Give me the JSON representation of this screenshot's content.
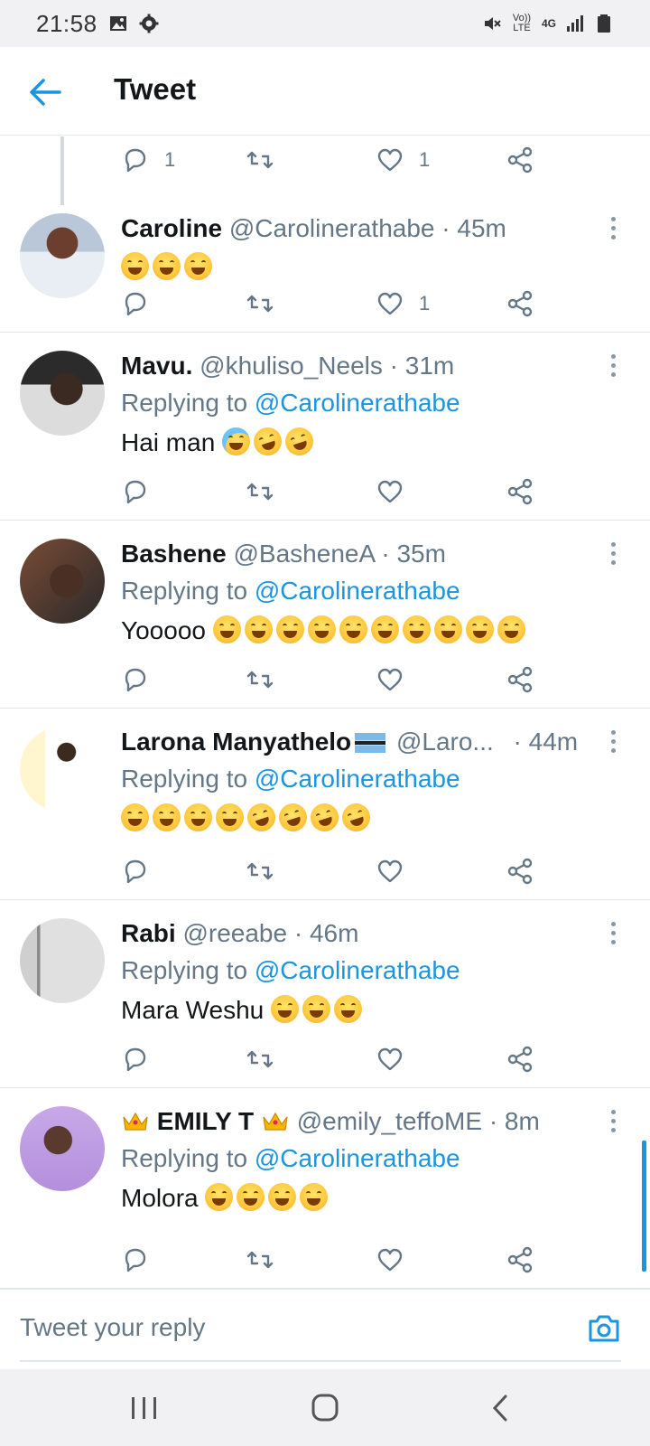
{
  "status_bar": {
    "time": "21:58",
    "left_icons": [
      "image-icon",
      "gear-icon"
    ],
    "right_icons": [
      "mute-icon",
      "volte-icon",
      "4g-icon",
      "signal-icon",
      "battery-icon"
    ],
    "volte_label": "Vo)) LTE",
    "network_label": "4G"
  },
  "header": {
    "title": "Tweet",
    "back_icon": "back-arrow-icon"
  },
  "colors": {
    "accent": "#1b95e0",
    "muted": "#657786",
    "text": "#14171a",
    "divider": "#e1e8ed"
  },
  "top_actions": {
    "reply_count": "1",
    "retweet_count": "",
    "like_count": "1"
  },
  "tweets": [
    {
      "name": "Caroline",
      "handle": "@Carolinerathabe",
      "time": "· 45m",
      "replying_prefix": "",
      "replying_to": "",
      "text": "",
      "emojis": [
        "laugh",
        "laugh",
        "laugh"
      ],
      "reply_count": "",
      "like_count": "1"
    },
    {
      "name": "Mavu.",
      "handle": "@khuliso_Neels",
      "time": "· 31m",
      "replying_prefix": "Replying to",
      "replying_to": "@Carolinerathabe",
      "text": "Hai man",
      "emojis": [
        "cry",
        "rofl",
        "rofl"
      ],
      "reply_count": "",
      "like_count": ""
    },
    {
      "name": "Bashene",
      "handle": "@BasheneA",
      "time": "· 35m",
      "replying_prefix": "Replying to",
      "replying_to": "@Carolinerathabe",
      "text": "Yooooo",
      "emojis": [
        "laugh",
        "laugh",
        "laugh",
        "laugh",
        "laugh",
        "laugh",
        "laugh",
        "laugh",
        "laugh",
        "laugh"
      ],
      "reply_count": "",
      "like_count": ""
    },
    {
      "name": "Larona Manyathelo",
      "handle": "@Laro...",
      "time": "· 44m",
      "replying_prefix": "Replying to",
      "replying_to": "@Carolinerathabe",
      "text": "",
      "emojis": [
        "laugh",
        "laugh",
        "laugh",
        "laugh",
        "rofl",
        "rofl",
        "rofl",
        "rofl"
      ],
      "reply_count": "",
      "like_count": ""
    },
    {
      "name": "Rabi",
      "handle": "@reeabe",
      "time": "· 46m",
      "replying_prefix": "Replying to",
      "replying_to": "@Carolinerathabe",
      "text": "Mara Weshu",
      "emojis": [
        "laugh",
        "laugh",
        "laugh"
      ],
      "reply_count": "",
      "like_count": ""
    },
    {
      "name": "EMILY T",
      "handle": "@emily_teffoME",
      "time": "· 8m",
      "replying_prefix": "Replying to",
      "replying_to": "@Carolinerathabe",
      "text": "Molora",
      "emojis": [
        "laugh",
        "laugh",
        "laugh",
        "laugh"
      ],
      "reply_count": "",
      "like_count": ""
    }
  ],
  "composer": {
    "placeholder": "Tweet your reply"
  }
}
